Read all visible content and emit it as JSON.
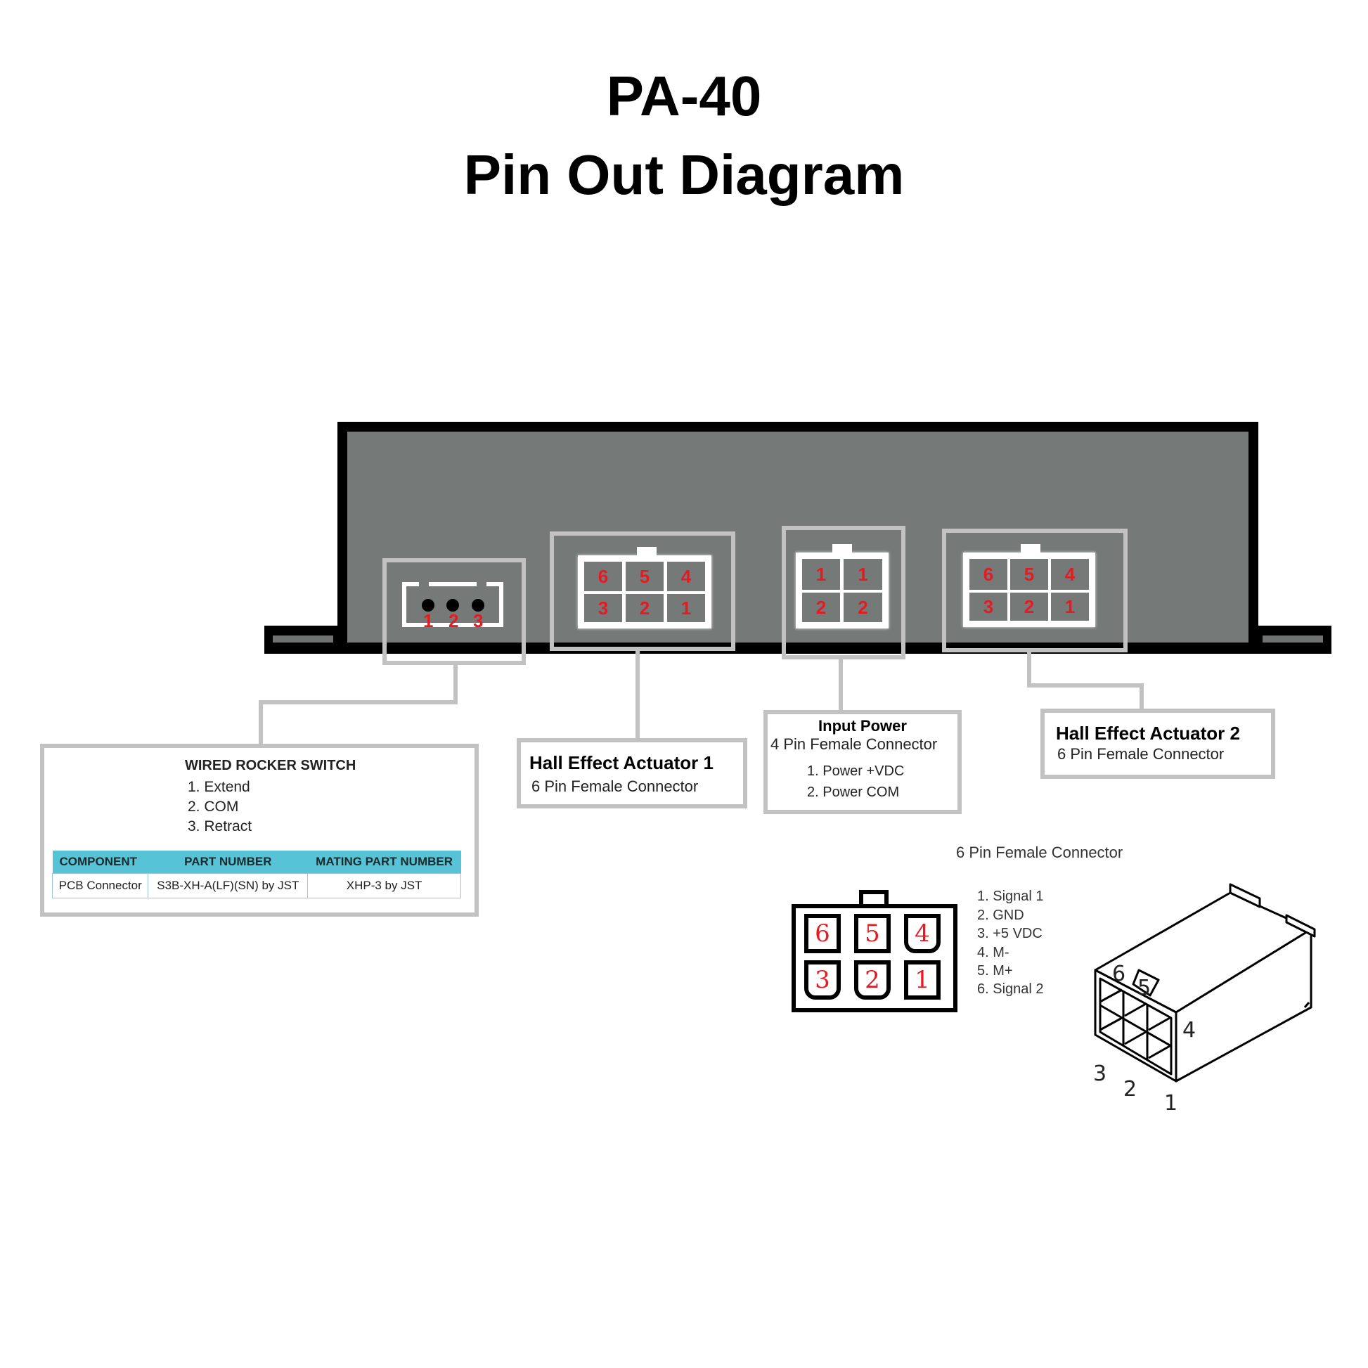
{
  "header": {
    "model": "PA-40",
    "subtitle": "Pin Out Diagram"
  },
  "colors": {
    "enclosure": "#757a79",
    "pin_label_red": "#e41b23",
    "frame_gray": "#c2c2c2",
    "table_header": "#57c3d6"
  },
  "ports": {
    "rocker": {
      "pins": [
        "1",
        "2",
        "3"
      ]
    },
    "hall1": {
      "top_row": [
        "6",
        "5",
        "4"
      ],
      "bottom_row": [
        "3",
        "2",
        "1"
      ]
    },
    "power": {
      "top_row": [
        "1",
        "1"
      ],
      "bottom_row": [
        "2",
        "2"
      ]
    },
    "hall2": {
      "top_row": [
        "6",
        "5",
        "4"
      ],
      "bottom_row": [
        "3",
        "2",
        "1"
      ]
    }
  },
  "rocker_box": {
    "title": "WIRED ROCKER SWITCH",
    "items": [
      "1. Extend",
      "2. COM",
      "3. Retract"
    ],
    "table": {
      "headers": [
        "COMPONENT",
        "PART NUMBER",
        "MATING PART NUMBER"
      ],
      "rows": [
        [
          "PCB Connector",
          "S3B-XH-A(LF)(SN) by JST",
          "XHP-3 by JST"
        ]
      ]
    }
  },
  "hall1_box": {
    "title": "Hall Effect Actuator 1",
    "subtitle": "6 Pin Female Connector"
  },
  "power_box": {
    "title": "Input Power",
    "subtitle": "4 Pin Female Connector",
    "items": [
      "1. Power +VDC",
      "2. Power COM"
    ]
  },
  "hall2_box": {
    "title": "Hall Effect Actuator 2",
    "subtitle": "6 Pin Female Connector"
  },
  "six_pin_detail": {
    "title": "6 Pin Female Connector",
    "top_row": [
      "6",
      "5",
      "4"
    ],
    "bottom_row": [
      "3",
      "2",
      "1"
    ],
    "pinout": [
      "1. Signal 1",
      "2. GND",
      "3. +5 VDC",
      "4. M-",
      "5. M+",
      "6. Signal 2"
    ],
    "iso_labels": [
      "6",
      "5",
      "4",
      "3",
      "2",
      "1"
    ]
  }
}
